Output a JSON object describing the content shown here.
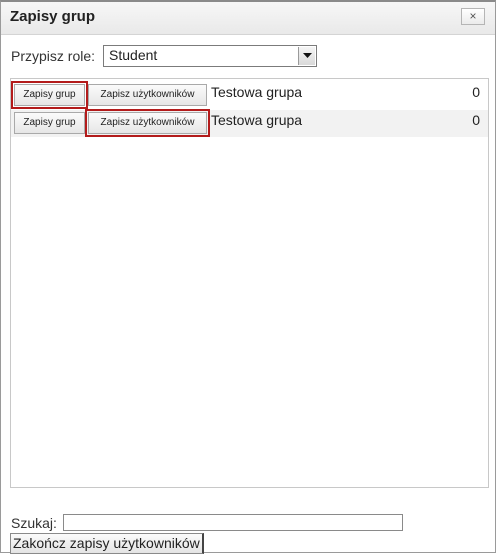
{
  "dialog": {
    "title": "Zapisy grup",
    "close_symbol": "×"
  },
  "role": {
    "label": "Przypisz role:",
    "selected": "Student"
  },
  "groups": [
    {
      "enrol_group_label": "Zapisy grup",
      "enrol_users_label": "Zapisz użytkowników",
      "name": "Testowa grupa",
      "count": "0"
    },
    {
      "enrol_group_label": "Zapisy grup",
      "enrol_users_label": "Zapisz użytkowników",
      "name": "Testowa grupa",
      "count": "0"
    }
  ],
  "search": {
    "label": "Szukaj:",
    "value": ""
  },
  "footer": {
    "finish_label": "Zakończ zapisy użytkowników"
  },
  "colors": {
    "highlight": "#b31b1b"
  }
}
